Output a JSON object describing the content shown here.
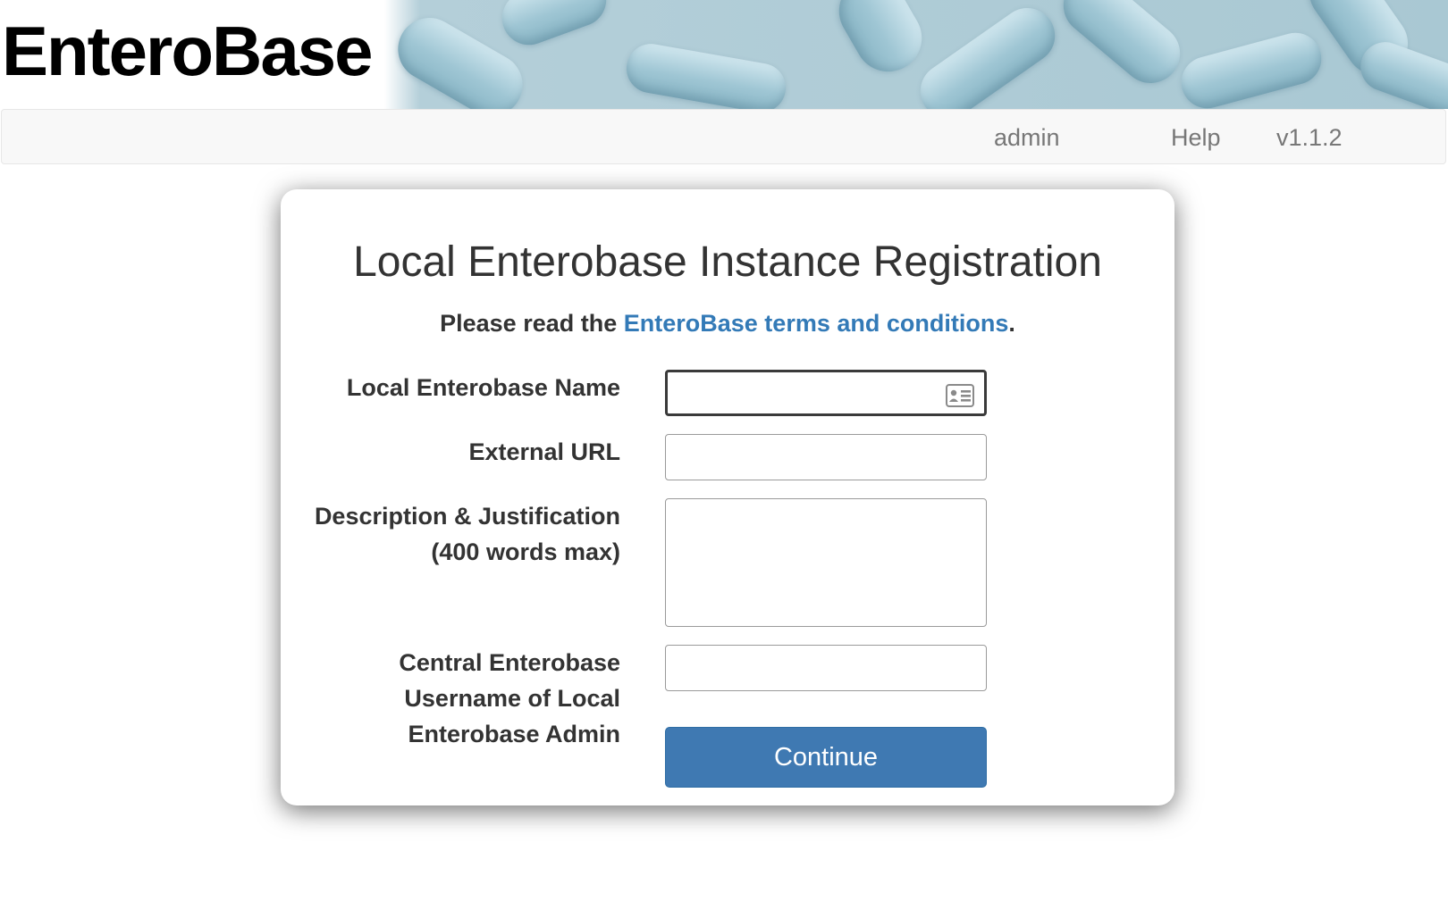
{
  "header": {
    "logo_text": "EnteroBase"
  },
  "navbar": {
    "items": [
      {
        "label": "admin"
      },
      {
        "label": "Help"
      },
      {
        "label": "v1.1.2"
      }
    ]
  },
  "form": {
    "title": "Local Enterobase Instance Registration",
    "terms_prefix": "Please read the ",
    "terms_link": "EnteroBase terms and conditions",
    "terms_suffix": ".",
    "fields": {
      "name": {
        "label": "Local Enterobase Name",
        "value": ""
      },
      "url": {
        "label": "External URL",
        "value": ""
      },
      "description": {
        "label_line1": "Description & Justification",
        "label_line2": "(400 words max)",
        "value": ""
      },
      "admin_username": {
        "label_line1": "Central Enterobase",
        "label_line2": "Username of Local",
        "label_line3": "Enterobase Admin",
        "value": ""
      }
    },
    "submit_label": "Continue"
  },
  "colors": {
    "link": "#337ab7",
    "button": "#3f79b2",
    "navbar_bg": "#f8f8f8",
    "banner": "#a9c8d3"
  },
  "icons": [
    "contact-card-icon"
  ]
}
